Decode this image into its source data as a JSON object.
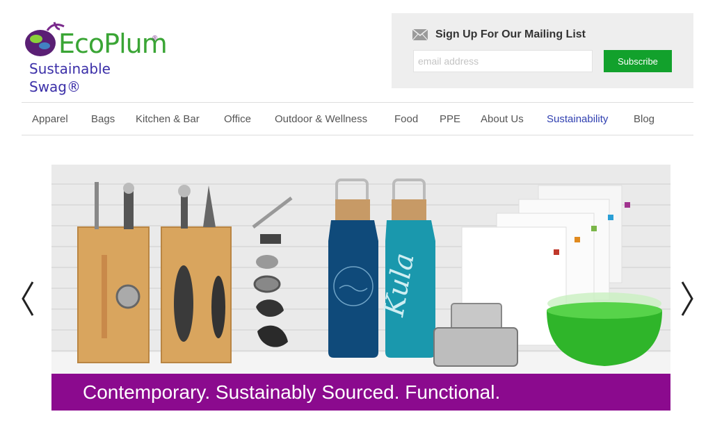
{
  "logo": {
    "word": "EcoPlum",
    "registered": "®",
    "tagline": "Sustainable Swag®"
  },
  "mailing": {
    "title": "Sign Up For Our Mailing List",
    "email_placeholder": "email address",
    "email_value": "",
    "subscribe_label": "Subscribe"
  },
  "nav": {
    "items": [
      {
        "label": "Apparel"
      },
      {
        "label": "Bags"
      },
      {
        "label": "Kitchen & Bar"
      },
      {
        "label": "Office"
      },
      {
        "label": "Outdoor & Wellness"
      },
      {
        "label": "Food"
      },
      {
        "label": "PPE"
      },
      {
        "label": "About Us"
      },
      {
        "label": "Sustainability",
        "active": true
      },
      {
        "label": "Blog"
      }
    ]
  },
  "carousel": {
    "caption": "Contemporary. Sustainably Sourced. Functional.",
    "bottle_text": "Kula",
    "prev_icon": "chevron-left-icon",
    "next_icon": "chevron-right-icon"
  },
  "colors": {
    "accent_green": "#12a12c",
    "nav_active": "#2f3fb0",
    "caption_bar": "#8b0a8e",
    "logo_purple": "#7a2a8c"
  }
}
